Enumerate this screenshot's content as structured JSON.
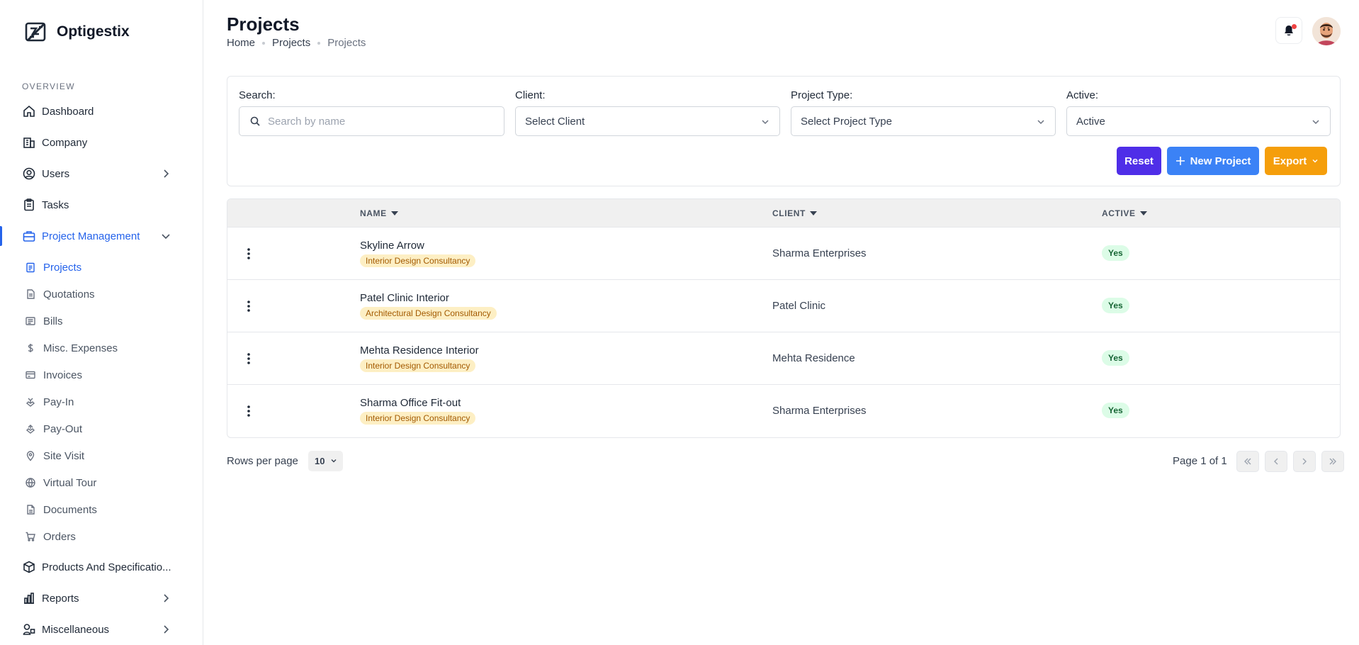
{
  "app": {
    "name": "Optigestix"
  },
  "sidebar": {
    "section_label": "OVERVIEW",
    "items": [
      {
        "label": "Dashboard",
        "icon": "home-icon"
      },
      {
        "label": "Company",
        "icon": "building-icon"
      },
      {
        "label": "Users",
        "icon": "user-circle-icon",
        "expandable": true
      },
      {
        "label": "Tasks",
        "icon": "clipboard-icon"
      },
      {
        "label": "Project Management",
        "icon": "briefcase-icon",
        "expanded": true,
        "active": true
      },
      {
        "label": "Products And Specificatio...",
        "icon": "box-icon"
      },
      {
        "label": "Reports",
        "icon": "bar-chart-icon",
        "expandable": true
      },
      {
        "label": "Miscellaneous",
        "icon": "shapes-icon",
        "expandable": true
      }
    ],
    "sub_items": [
      {
        "label": "Projects",
        "icon": "clipboard-list-icon",
        "current": true
      },
      {
        "label": "Quotations",
        "icon": "file-text-icon"
      },
      {
        "label": "Bills",
        "icon": "receipt-icon"
      },
      {
        "label": "Misc. Expenses",
        "icon": "dollar-icon"
      },
      {
        "label": "Invoices",
        "icon": "invoice-icon"
      },
      {
        "label": "Pay-In",
        "icon": "hand-coin-icon"
      },
      {
        "label": "Pay-Out",
        "icon": "hand-send-icon"
      },
      {
        "label": "Site Visit",
        "icon": "map-pin-icon"
      },
      {
        "label": "Virtual Tour",
        "icon": "globe-icon"
      },
      {
        "label": "Documents",
        "icon": "document-icon"
      },
      {
        "label": "Orders",
        "icon": "cart-icon"
      }
    ]
  },
  "header": {
    "title": "Projects",
    "breadcrumb": [
      "Home",
      "Projects",
      "Projects"
    ]
  },
  "filters": {
    "search_label": "Search:",
    "search_placeholder": "Search by name",
    "client_label": "Client:",
    "client_value": "Select Client",
    "type_label": "Project Type:",
    "type_value": "Select Project Type",
    "active_label": "Active:",
    "active_value": "Active"
  },
  "actions": {
    "reset": "Reset",
    "new_project": "New Project",
    "export": "Export"
  },
  "table": {
    "columns": [
      "NAME",
      "CLIENT",
      "ACTIVE"
    ],
    "rows": [
      {
        "name": "Skyline Arrow",
        "type": "Interior Design Consultancy",
        "client": "Sharma Enterprises",
        "active": "Yes"
      },
      {
        "name": "Patel Clinic Interior",
        "type": "Architectural Design Consultancy",
        "client": "Patel Clinic",
        "active": "Yes"
      },
      {
        "name": "Mehta Residence Interior",
        "type": "Interior Design Consultancy",
        "client": "Mehta Residence",
        "active": "Yes"
      },
      {
        "name": "Sharma Office Fit-out",
        "type": "Interior Design Consultancy",
        "client": "Sharma Enterprises",
        "active": "Yes"
      }
    ]
  },
  "pagination": {
    "rows_per_page_label": "Rows per page",
    "rows_per_page": "10",
    "page_info": "Page 1 of 1"
  },
  "colors": {
    "accent_blue": "#2563eb",
    "reset_purple": "#4f2ee8",
    "new_blue": "#3b82f6",
    "export_orange": "#f59e0b",
    "active_green": "#166534",
    "notification_red": "#ef4444"
  }
}
